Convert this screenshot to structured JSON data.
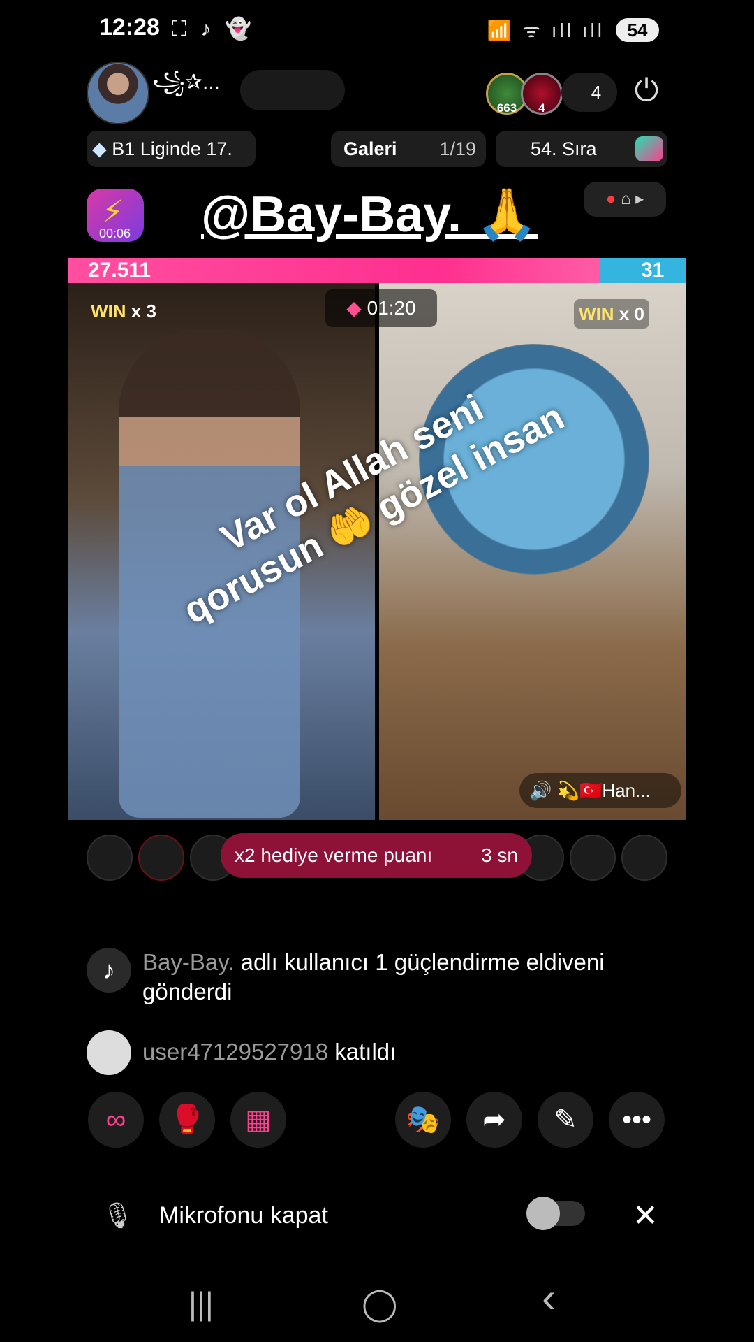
{
  "status_bar": {
    "time": "12:28",
    "left_icons": "⛶ ♪ 👻",
    "right_icons": "📶 ᯤ ıll ıll",
    "battery": "54"
  },
  "header": {
    "host_name": "꧁✰...",
    "viewers": {
      "gift1_count": "663",
      "gift2_count": "4",
      "total": "4"
    }
  },
  "ranking": {
    "league": "B1 Liginde 17.",
    "gallery_label": "Galeri",
    "gallery_pos": "1/19",
    "rank": "54. Sıra"
  },
  "battle": {
    "mention": "@Bay-Bay. 🙏",
    "timer_badge": "00:06",
    "score_left": "27.511",
    "score_right": "31",
    "score_left_fraction": 0.86,
    "win_left_label": "WIN",
    "win_left_count": "x 3",
    "win_right_label": "WIN",
    "win_right_count": "x 0",
    "countdown": "01:20",
    "overlay_text": "Var ol Allah seni qorusun 🤲 gözel insan",
    "audio_label": "🔊 💫🇹🇷Han..."
  },
  "bonus": {
    "label": "x2 hediye verme puanı",
    "seconds": "3 sn"
  },
  "chat": [
    {
      "user": "Bay-Bay.",
      "text": " adlı kullanıcı 1 güçlendirme eldiveni gönderdi"
    },
    {
      "user": "user47129527918",
      "text": " katıldı"
    }
  ],
  "actions": {
    "btn1": "∞",
    "btn2": "🥊",
    "btn3": "▦",
    "btn4": "🎭",
    "btn5": "➦",
    "btn6": "✎",
    "btn7": "•••"
  },
  "mic": {
    "label": "Mikrofonu kapat",
    "icon": "🎙",
    "close": "✕"
  },
  "nav": {
    "recents": "|||",
    "home": "◯",
    "back": "‹"
  }
}
